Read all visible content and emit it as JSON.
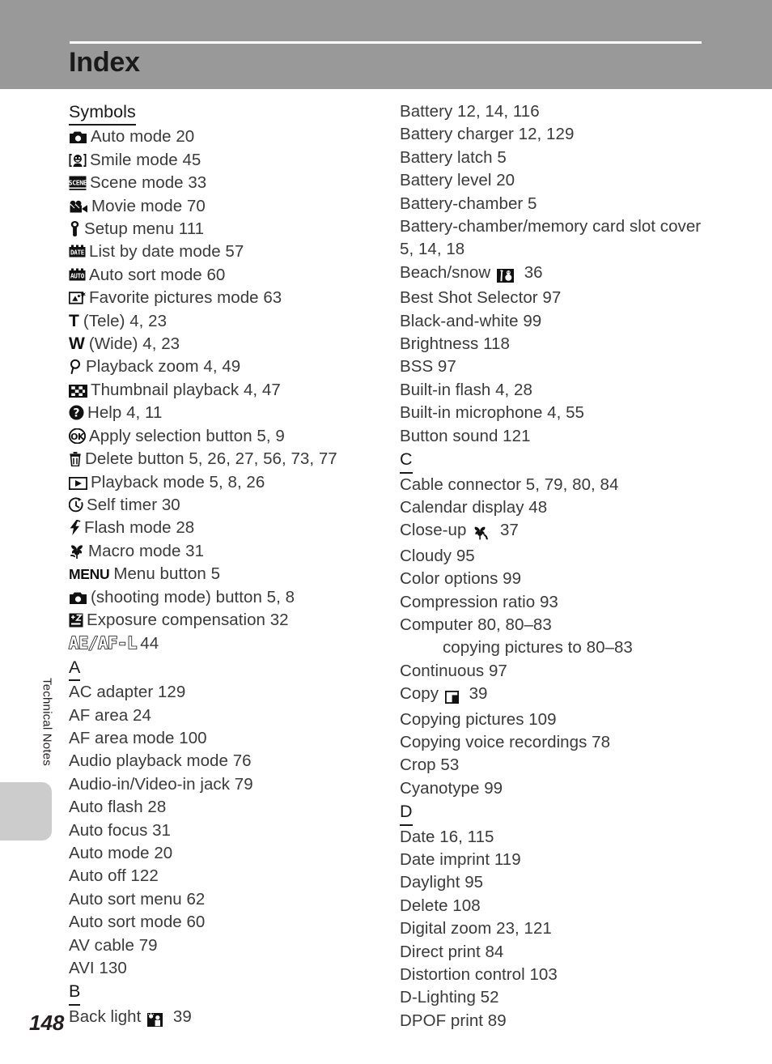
{
  "header": {
    "title": "Index"
  },
  "side_tab": {
    "label": "Technical Notes"
  },
  "footer": {
    "page_number": "148"
  },
  "colors": {
    "header_band": "#999999",
    "header_rule": "#ffffff",
    "side_tab": "#cccccc",
    "body_text": "#3a3a3a"
  },
  "left_column": [
    {
      "type": "section",
      "label": "Symbols"
    },
    {
      "type": "entry",
      "icon": "camera-auto-icon",
      "text": "Auto mode 20"
    },
    {
      "type": "entry",
      "icon": "smile-face-icon",
      "text": "Smile mode 45"
    },
    {
      "type": "entry",
      "icon": "scene-icon",
      "text": "Scene mode 33"
    },
    {
      "type": "entry",
      "icon": "movie-camera-icon",
      "text": "Movie mode 70"
    },
    {
      "type": "entry",
      "icon": "wrench-icon",
      "text": "Setup menu 111"
    },
    {
      "type": "entry",
      "icon": "date-icon",
      "text": "List by date mode 57"
    },
    {
      "type": "entry",
      "icon": "auto-sort-icon",
      "text": "Auto sort mode 60"
    },
    {
      "type": "entry",
      "icon": "favorite-pictures-icon",
      "text": "Favorite pictures mode 63"
    },
    {
      "type": "entry",
      "icon": "tele-t-icon",
      "text": "(Tele) 4, 23"
    },
    {
      "type": "entry",
      "icon": "wide-w-icon",
      "text": "(Wide) 4, 23"
    },
    {
      "type": "entry",
      "icon": "magnifier-icon",
      "text": "Playback zoom 4, 49"
    },
    {
      "type": "entry",
      "icon": "thumbnail-grid-icon",
      "text": "Thumbnail playback 4, 47"
    },
    {
      "type": "entry",
      "icon": "help-question-icon",
      "text": "Help 4, 11"
    },
    {
      "type": "entry",
      "icon": "ok-button-icon",
      "text": "Apply selection button 5, 9"
    },
    {
      "type": "entry",
      "icon": "trash-icon",
      "text": "Delete button 5, 26, 27, 56, 73, 77"
    },
    {
      "type": "entry",
      "icon": "playback-triangle-icon",
      "text": "Playback mode 5, 8, 26"
    },
    {
      "type": "entry",
      "icon": "self-timer-icon",
      "text": "Self timer 30"
    },
    {
      "type": "entry",
      "icon": "flash-bolt-icon",
      "text": "Flash mode 28"
    },
    {
      "type": "entry",
      "icon": "macro-flower-icon",
      "text": "Macro mode 31"
    },
    {
      "type": "entry",
      "icon": "menu-button-icon",
      "text": "Menu button 5"
    },
    {
      "type": "entry",
      "icon": "camera-auto-icon",
      "text": "(shooting mode) button 5, 8"
    },
    {
      "type": "entry",
      "icon": "exposure-compensation-icon",
      "text": "Exposure compensation 32"
    },
    {
      "type": "entry",
      "icon": "ae-af-lock-icon",
      "text": "44"
    },
    {
      "type": "section",
      "label": "A"
    },
    {
      "type": "entry",
      "text": "AC adapter 129"
    },
    {
      "type": "entry",
      "text": "AF area 24"
    },
    {
      "type": "entry",
      "text": "AF area mode 100"
    },
    {
      "type": "entry",
      "text": "Audio playback mode 76"
    },
    {
      "type": "entry",
      "text": "Audio-in/Video-in jack 79"
    },
    {
      "type": "entry",
      "text": "Auto flash 28"
    },
    {
      "type": "entry",
      "text": "Auto focus 31"
    },
    {
      "type": "entry",
      "text": "Auto mode 20"
    },
    {
      "type": "entry",
      "text": "Auto off 122"
    },
    {
      "type": "entry",
      "text": "Auto sort menu 62"
    },
    {
      "type": "entry",
      "text": "Auto sort mode 60"
    },
    {
      "type": "entry",
      "text": "AV cable 79"
    },
    {
      "type": "entry",
      "text": "AVI 130"
    },
    {
      "type": "section",
      "label": "B"
    },
    {
      "type": "entry",
      "text_before": "Back light",
      "icon_mid": "backlight-scene-icon",
      "text_after": "39"
    }
  ],
  "right_column": [
    {
      "type": "entry",
      "text": "Battery 12, 14, 116"
    },
    {
      "type": "entry",
      "text": "Battery charger 12, 129"
    },
    {
      "type": "entry",
      "text": "Battery latch 5"
    },
    {
      "type": "entry",
      "text": "Battery level 20"
    },
    {
      "type": "entry",
      "text": "Battery-chamber 5"
    },
    {
      "type": "entry",
      "text": "Battery-chamber/memory card slot cover"
    },
    {
      "type": "entry",
      "text": "5, 14, 18"
    },
    {
      "type": "entry",
      "text_before": "Beach/snow",
      "icon_mid": "beach-snow-icon",
      "text_after": "36"
    },
    {
      "type": "entry",
      "text": "Best Shot Selector 97"
    },
    {
      "type": "entry",
      "text": "Black-and-white 99"
    },
    {
      "type": "entry",
      "text": "Brightness 118"
    },
    {
      "type": "entry",
      "text": "BSS 97"
    },
    {
      "type": "entry",
      "text": "Built-in flash 4, 28"
    },
    {
      "type": "entry",
      "text": "Built-in microphone 4, 55"
    },
    {
      "type": "entry",
      "text": "Button sound 121"
    },
    {
      "type": "section",
      "label": "C"
    },
    {
      "type": "entry",
      "text": "Cable connector 5, 79, 80, 84"
    },
    {
      "type": "entry",
      "text": "Calendar display 48"
    },
    {
      "type": "entry",
      "text_before": "Close-up",
      "icon_mid": "close-up-icon",
      "text_after": "37"
    },
    {
      "type": "entry",
      "text": "Cloudy 95"
    },
    {
      "type": "entry",
      "text": "Color options 99"
    },
    {
      "type": "entry",
      "text": "Compression ratio 93"
    },
    {
      "type": "entry",
      "text": "Computer 80, 80–83"
    },
    {
      "type": "subentry",
      "text": "copying pictures to 80–83"
    },
    {
      "type": "entry",
      "text": "Continuous 97"
    },
    {
      "type": "entry",
      "text_before": "Copy",
      "icon_mid": "copy-icon",
      "text_after": "39"
    },
    {
      "type": "entry",
      "text": "Copying pictures 109"
    },
    {
      "type": "entry",
      "text": "Copying voice recordings 78"
    },
    {
      "type": "entry",
      "text": "Crop 53"
    },
    {
      "type": "entry",
      "text": "Cyanotype 99"
    },
    {
      "type": "section",
      "label": "D"
    },
    {
      "type": "entry",
      "text": "Date 16, 115"
    },
    {
      "type": "entry",
      "text": "Date imprint 119"
    },
    {
      "type": "entry",
      "text": "Daylight 95"
    },
    {
      "type": "entry",
      "text": "Delete 108"
    },
    {
      "type": "entry",
      "text": "Digital zoom 23, 121"
    },
    {
      "type": "entry",
      "text": "Direct print 84"
    },
    {
      "type": "entry",
      "text": "Distortion control 103"
    },
    {
      "type": "entry",
      "text": "D-Lighting 52"
    },
    {
      "type": "entry",
      "text": "DPOF print 89"
    }
  ]
}
